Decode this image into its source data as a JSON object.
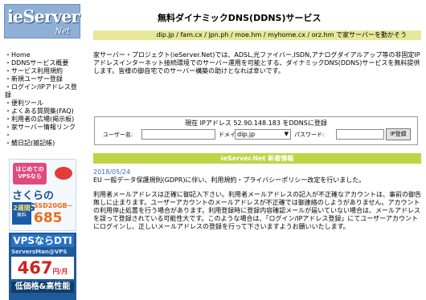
{
  "header": {
    "logo_text": "ieServer",
    "logo_sub": "Net",
    "site_title": "無料ダイナミックDNS(DDNS)サービス",
    "domain_bar": "dip.jp / fam.cx / jpn.ph / moe.hm / myhome.cx / orz.hm で家サーバーを動かそう"
  },
  "nav": {
    "items": [
      "Home",
      "DDNSサービス概要",
      "サービス利用規約",
      "新規ユーザー登録",
      "ログイン/IPアドレス登録",
      "便利ツール",
      "よくある質問集(FAQ)",
      "利用者の広場(掲示板)",
      "家サーバー情報リンク",
      "",
      "鯖日記(雑記帳)"
    ]
  },
  "intro": {
    "text": "家サーバー・プロジェクト(ieServer.Net)では、ADSL,光ファイバー,ISDN,アナログダイアルアップ等の非固定IPアドレスインターネット接続環境でのサーバー運用を可能とする、ダイナミックDNS(DDNS)サービスを無料提供します。皆様の御自宅でのサーバー構築の助けとなれば幸いです。"
  },
  "login": {
    "title": "現在 IPアドレス 52.90.148.183 をDDNSに登録",
    "user_label": "ユーザー名:",
    "user_value": "",
    "domain_label": "ドメイン名:",
    "domain_value": "dip.jp",
    "password_label": "パスワード:",
    "password_value": "",
    "button_label": "IP登録"
  },
  "news": {
    "heading": "ieServer.Net 新着情報",
    "date": "2018/05/24",
    "line1": "EU 一般データ保護規則(GDPR)に伴い、利用規約・プライバシーポリシー改定を行いました。",
    "body": "利用者メールアドレスは正確に御記入下さい。利用者メールアドレスの記入が不正確なアカウントは、事前の御告無しに止まります。ユーザーアカウントのメールアドレスが不正確では御連絡のしようがありません。アカウントの利用停止処置を行う場合があります。利用登録時に登録内容確認メールが届いていない場合は、メールアドレスを誤って登録されている可能性大です。このような場合は、「ログイン/IPアドレス登録」にてユーザーアカウントにログインし、正しいメールアドレスの登録を行って下さいますようお願いいたします。"
  },
  "ads": {
    "ad1": {
      "top": "はじめてのVPSなら",
      "brand": "さくらのVPS",
      "days_line1": "2週間",
      "days_line2": "無料",
      "ssd": "SSD20GB~",
      "price": "685円~"
    },
    "ad2": {
      "title": "VPSならDTI",
      "sub": "ServersMan@VPS",
      "price": "467",
      "price_unit": "円/月",
      "tagline": "低価格&高性能"
    }
  }
}
